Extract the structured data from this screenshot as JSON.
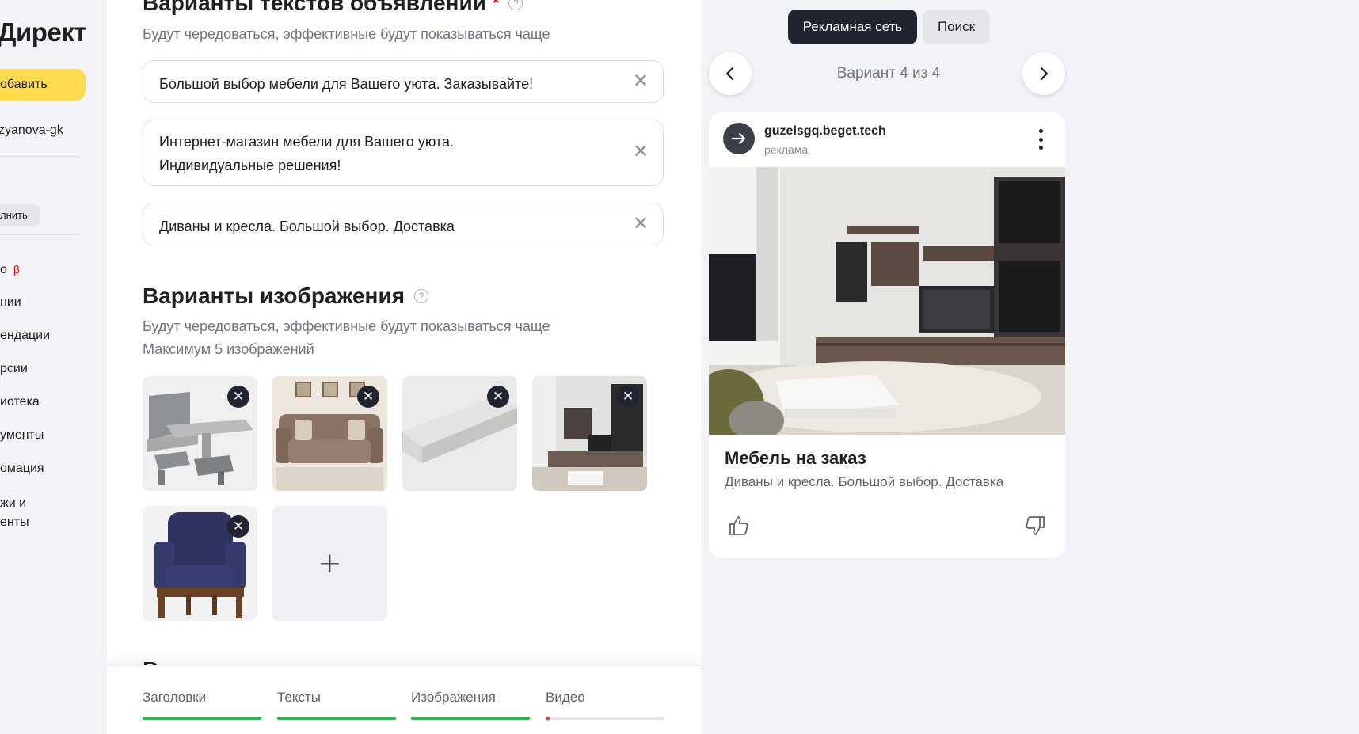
{
  "sidebar": {
    "brand": "Директ",
    "add_label": "обавить",
    "account": "zyanova-gk",
    "fill_label": "лнить",
    "items": [
      {
        "label": "о",
        "beta": "β"
      },
      {
        "label": "нии"
      },
      {
        "label": "ендации"
      },
      {
        "label": "рсии"
      },
      {
        "label": "иотека"
      },
      {
        "label": "ументы"
      },
      {
        "label": "омация"
      },
      {
        "label": "жи и"
      },
      {
        "label": "енты"
      }
    ]
  },
  "texts_section": {
    "title": "Варианты текстов объявлений",
    "required_mark": "*",
    "help": "?",
    "subtitle": "Будут чередоваться, эффективные будут показываться чаще",
    "fields": [
      {
        "value": "Большой выбор мебели для Вашего уюта. Заказывайте!"
      },
      {
        "value": "Интернет-магазин мебели для Вашего уюта. Индивидуальные решения!"
      },
      {
        "value": "Диваны и кресла. Большой выбор. Доставка"
      }
    ],
    "remove_glyph": "✕"
  },
  "images_section": {
    "title": "Варианты изображения",
    "help": "?",
    "subtitle": "Будут чередоваться, эффективные будут показываться чаще",
    "limit": "Максимум 5 изображений",
    "images": [
      {
        "icon": "kitchen-table-image"
      },
      {
        "icon": "sofa-image"
      },
      {
        "icon": "mattress-image"
      },
      {
        "icon": "living-room-wall-image"
      },
      {
        "icon": "armchair-image"
      }
    ],
    "remove_glyph": "✕",
    "add_glyph": "+"
  },
  "next_section_peek": "Видео",
  "progress_tabs": [
    {
      "label": "Заголовки",
      "progress": 1.0,
      "color": "#2fb24b"
    },
    {
      "label": "Тексты",
      "progress": 1.0,
      "color": "#2fb24b"
    },
    {
      "label": "Изображения",
      "progress": 1.0,
      "color": "#2fb24b"
    },
    {
      "label": "Видео",
      "progress": 0.03,
      "color": "#f33"
    }
  ],
  "preview": {
    "segments": {
      "active": "Рекламная сеть",
      "inactive": "Поиск"
    },
    "variant_label": "Вариант 4 из 4",
    "card": {
      "site": "guzelsgq.beget.tech",
      "site_sub": "реклама",
      "title": "Мебель на заказ",
      "text": "Диваны и кресла. Большой выбор. Доставка"
    }
  },
  "colors": {
    "accent_yellow": "#ffdb4d",
    "dark": "#1f2430",
    "progress_green": "#2fb24b"
  }
}
